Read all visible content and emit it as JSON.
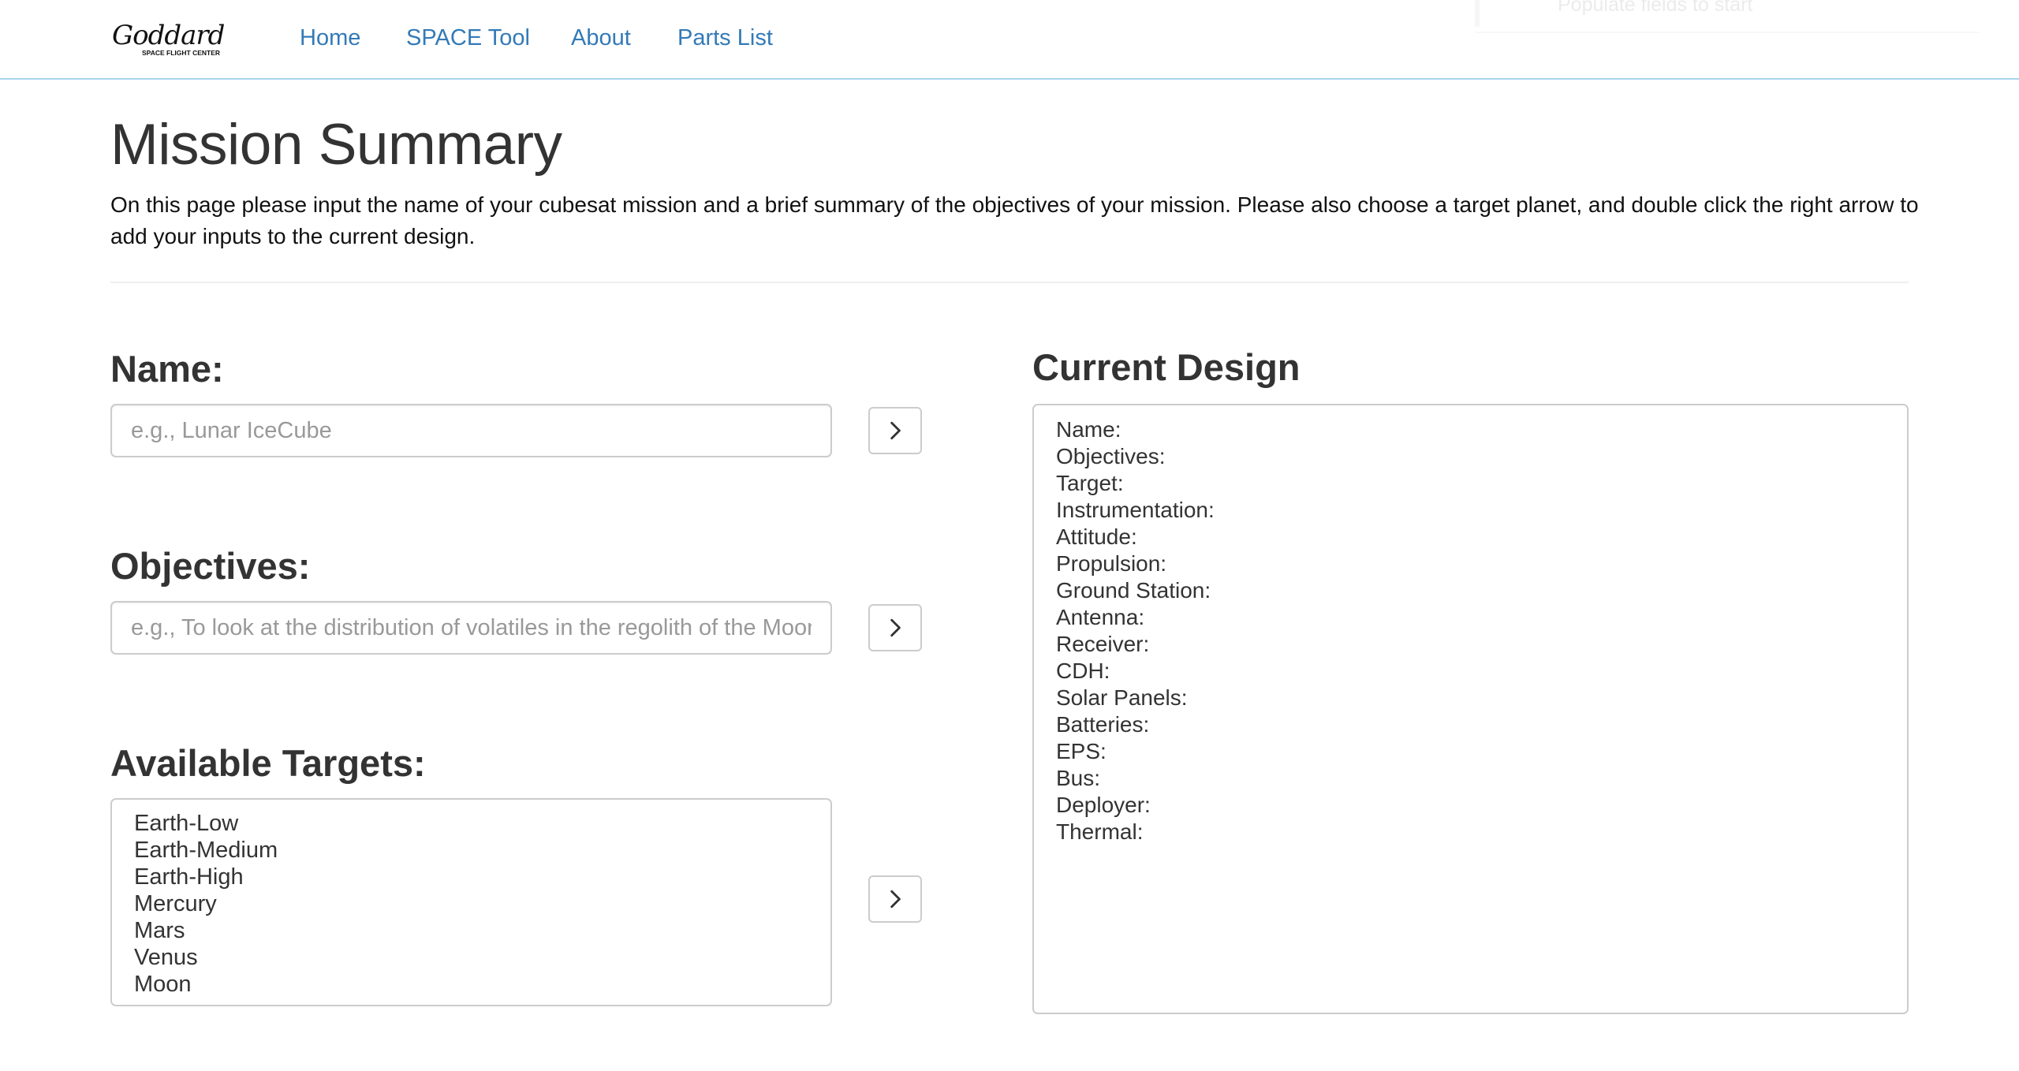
{
  "nav": {
    "brand_name": "Goddard",
    "brand_subtitle": "SPACE FLIGHT CENTER",
    "links": [
      "Home",
      "SPACE Tool",
      "About",
      "Parts List"
    ],
    "ghost_text": "Populate fields to start"
  },
  "page": {
    "title": "Mission Summary",
    "intro": "On this page please input the name of your cubesat mission and a brief summary of the objectives of your mission. Please also choose a target planet, and double click the right arrow to add your inputs to the current design."
  },
  "name_section": {
    "label": "Name:",
    "placeholder": "e.g., Lunar IceCube",
    "value": ""
  },
  "objectives_section": {
    "label": "Objectives:",
    "placeholder": "e.g., To look at the distribution of volatiles in the regolith of the Moon",
    "value": ""
  },
  "targets_section": {
    "label": "Available Targets:",
    "options": [
      "Earth-Low",
      "Earth-Medium",
      "Earth-High",
      "Mercury",
      "Mars",
      "Venus",
      "Moon"
    ]
  },
  "current_design": {
    "title": "Current Design",
    "fields": [
      "Name:",
      "Objectives:",
      "Target:",
      "Instrumentation:",
      "Attitude:",
      "Propulsion:",
      "Ground Station:",
      "Antenna:",
      "Receiver:",
      "CDH:",
      "Solar Panels:",
      "Batteries:",
      "EPS:",
      "Bus:",
      "Deployer:",
      "Thermal:"
    ]
  },
  "icons": {
    "arrow": "chevron-right-icon",
    "logo": "goddard-logo"
  },
  "colors": {
    "link": "#337ab7",
    "nav_border": "#a9d4ec",
    "text": "#333333",
    "input_border": "#cccccc"
  }
}
